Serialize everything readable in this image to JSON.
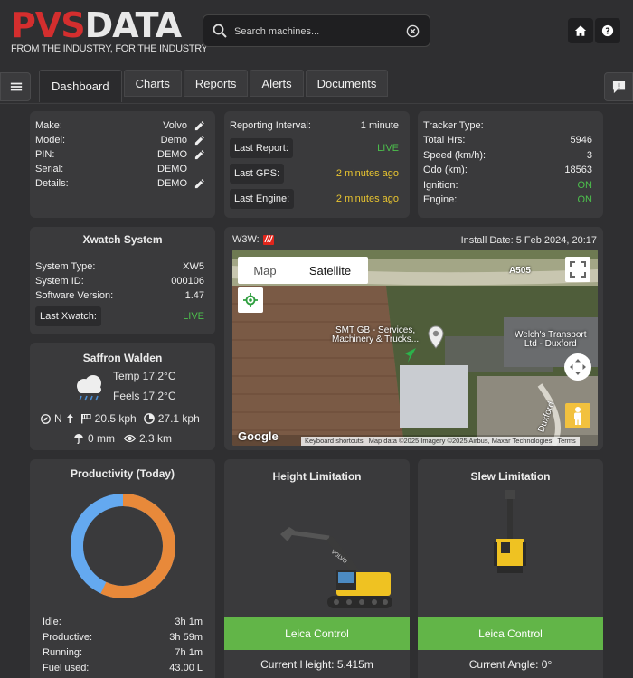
{
  "header": {
    "logo_primary": "PVS",
    "logo_secondary": "DATA",
    "tagline": "FROM THE INDUSTRY, FOR THE INDUSTRY",
    "search_placeholder": "Search machines...",
    "icons": [
      "search-icon",
      "clear-icon",
      "home-icon",
      "help-icon"
    ]
  },
  "nav": {
    "tabs": [
      {
        "label": "Dashboard",
        "active": true
      },
      {
        "label": "Charts"
      },
      {
        "label": "Reports"
      },
      {
        "label": "Alerts"
      },
      {
        "label": "Documents"
      }
    ]
  },
  "machine": {
    "rows": [
      {
        "label": "Make:",
        "value": "Volvo",
        "editable": true
      },
      {
        "label": "Model:",
        "value": "Demo",
        "editable": true
      },
      {
        "label": "PIN:",
        "value": "DEMO",
        "editable": true
      },
      {
        "label": "Serial:",
        "value": "DEMO",
        "editable": false
      },
      {
        "label": "Details:",
        "value": "DEMO",
        "editable": true
      }
    ]
  },
  "reporting": {
    "interval_label": "Reporting Interval:",
    "interval_value": "1 minute",
    "last_report_label": "Last Report:",
    "last_report_value": "LIVE",
    "last_gps_label": "Last GPS:",
    "last_gps_value": "2 minutes ago",
    "last_engine_label": "Last Engine:",
    "last_engine_value": "2 minutes ago"
  },
  "tracker": {
    "rows": [
      {
        "label": "Tracker Type:",
        "value": ""
      },
      {
        "label": "Total Hrs:",
        "value": "5946"
      },
      {
        "label": "Speed (km/h):",
        "value": "3"
      },
      {
        "label": "Odo (km):",
        "value": "18563"
      },
      {
        "label": "Ignition:",
        "value": "ON"
      },
      {
        "label": "Engine:",
        "value": "ON"
      }
    ]
  },
  "xwatch": {
    "title": "Xwatch System",
    "rows": [
      {
        "label": "System Type:",
        "value": "XW5"
      },
      {
        "label": "System ID:",
        "value": "000106"
      },
      {
        "label": "Software Version:",
        "value": "1.47"
      }
    ],
    "last_label": "Last Xwatch:",
    "last_value": "LIVE"
  },
  "weather": {
    "location": "Saffron Walden",
    "temp": "Temp 17.2°C",
    "feels": "Feels 17.2°C",
    "direction": "N",
    "wind": "20.5 kph",
    "gust": "27.1 kph",
    "rain": "0 mm",
    "visibility": "2.3 km"
  },
  "map": {
    "w3w_label": "W3W:",
    "w3w_mark": "///",
    "install_date": "Install Date: 5 Feb 2024, 20:17",
    "map_tab": "Map",
    "satellite_tab": "Satellite",
    "road_label": "A505",
    "poi_1_line1": "SMT GB - Services,",
    "poi_1_line2": "Machinery & Trucks...",
    "poi_2_line1": "Welch's Transport",
    "poi_2_line2": "Ltd - Duxford",
    "poi_3": "Duxford",
    "google": "Google",
    "footer_shortcuts": "Keyboard shortcuts",
    "footer_data": "Map data ©2025 Imagery ©2025 Airbus, Maxar Technologies",
    "footer_terms": "Terms"
  },
  "productivity": {
    "title": "Productivity (Today)",
    "rows": [
      {
        "label": "Idle:",
        "value": "3h 1m"
      },
      {
        "label": "Productive:",
        "value": "3h 59m"
      },
      {
        "label": "Running:",
        "value": "7h 1m"
      },
      {
        "label": "Fuel used:",
        "value": "43.00 L"
      }
    ],
    "donut": {
      "productive_fraction": 0.5688,
      "productive_color": "#e8893a",
      "idle_color": "#64a9f0"
    }
  },
  "height": {
    "title": "Height Limitation",
    "button": "Leica Control",
    "current": "Current Height: 5.415m"
  },
  "slew": {
    "title": "Slew Limitation",
    "button": "Leica Control",
    "current": "Current Angle: 0°"
  },
  "colors": {
    "live": "#4cbf4c",
    "warn": "#e9c530",
    "accent_red": "#d42e2e",
    "button_green": "#62b548"
  }
}
